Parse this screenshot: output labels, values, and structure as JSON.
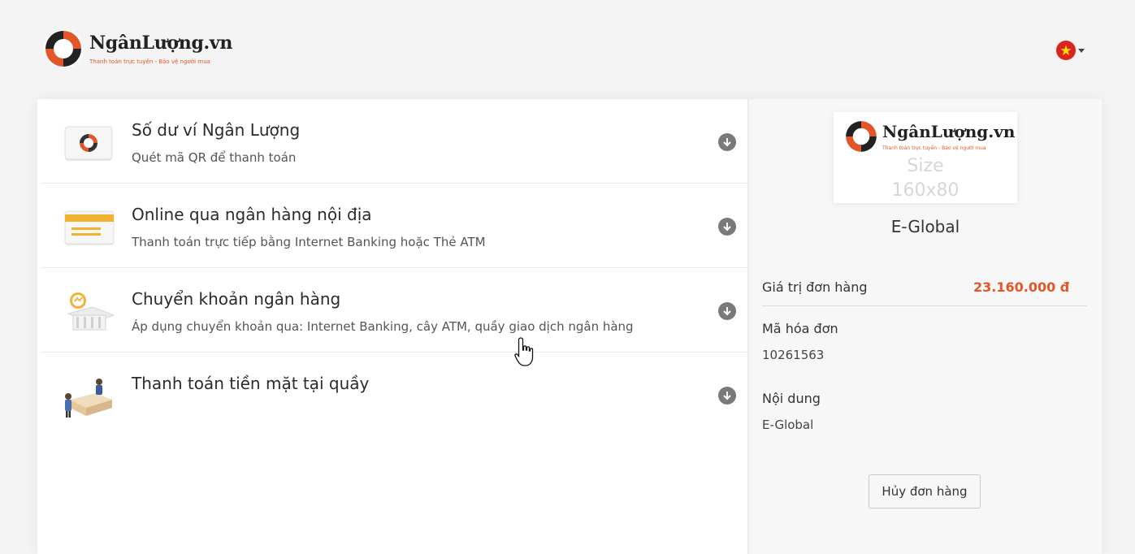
{
  "header": {
    "logo_name": "NgânLượng.vn",
    "logo_tagline": "Thanh toán trực tuyến - Bảo vệ người mua",
    "language_icon": "vietnam-flag-icon"
  },
  "payment_methods": [
    {
      "title": "Số dư ví Ngân Lượng",
      "description": "Quét mã QR để thanh toán",
      "icon": "wallet-icon"
    },
    {
      "title": "Online qua ngân hàng nội địa",
      "description": "Thanh toán trực tiếp bằng Internet Banking hoặc Thẻ ATM",
      "icon": "card-icon"
    },
    {
      "title": "Chuyển khoản ngân hàng",
      "description": "Áp dụng chuyển khoản qua: Internet Banking, cây ATM, quầy giao dịch ngân hàng",
      "icon": "bank-icon"
    },
    {
      "title": "Thanh toán tiền mặt tại quầy",
      "description": "",
      "icon": "counter-icon"
    }
  ],
  "summary": {
    "merchant_logo_name": "NgânLượng.vn",
    "merchant_logo_tagline": "Thanh toán trực tuyến - Bảo vệ người mua",
    "size_line1": "Size",
    "size_line2": "160x80",
    "merchant_name": "E-Global",
    "order_value_label": "Giá trị đơn hàng",
    "order_value": "23.160.000 đ",
    "invoice_label": "Mã hóa đơn",
    "invoice_value": "10261563",
    "content_label": "Nội dung",
    "content_value": "E-Global",
    "cancel_label": "Hủy đơn hàng"
  },
  "colors": {
    "brand_orange": "#e2562a",
    "flag_red": "#da251d"
  }
}
